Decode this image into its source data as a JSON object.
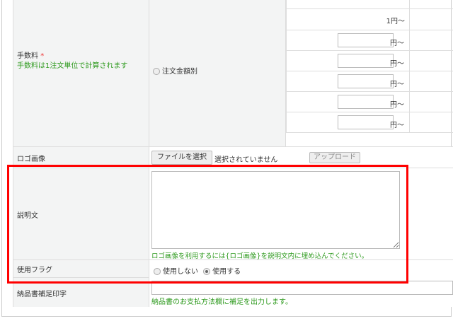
{
  "fee": {
    "label": "手数料",
    "required_mark": "*",
    "note": "手数料は1注文単位で計算されます",
    "radio_label": "注文金額別",
    "first_row": "1円〜",
    "suffix": "円〜",
    "rows": [
      "",
      "",
      "",
      "",
      ""
    ]
  },
  "logo": {
    "label": "ロゴ画像",
    "choose_file": "ファイルを選択",
    "no_file": "選択されていません",
    "upload": "アップロード"
  },
  "description": {
    "label": "説明文",
    "value": "",
    "hint": "ロゴ画像を利用するには{ロゴ画像}を説明文内に埋め込んでください。"
  },
  "use_flag": {
    "label": "使用フラグ",
    "options": [
      "使用しない",
      "使用する"
    ],
    "selected": "使用する"
  },
  "delivery_note": {
    "label": "納品書補足印字",
    "value": "",
    "hint": "納品書のお支払方法欄に補足を出力します。"
  },
  "highlight_color": "#ff0000"
}
